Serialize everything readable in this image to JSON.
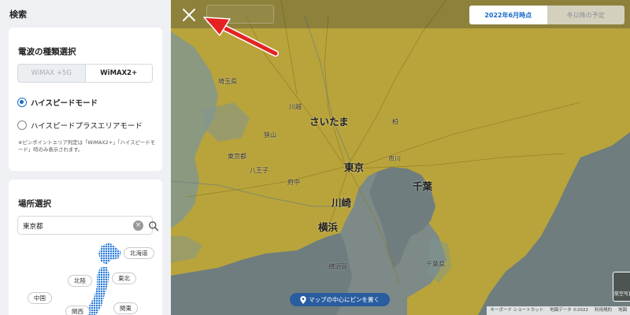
{
  "sidebar": {
    "title": "検索",
    "wave_section": {
      "heading": "電波の種類選択",
      "tabs": [
        "WiMAX +5G",
        "WiMAX2+"
      ],
      "modes": [
        "ハイスピードモード",
        "ハイスピードプラスエリアモード"
      ],
      "note": "※ピンポイントエリア判定は「WiMAX2+」「ハイスピードモード」時のみ表示されます。"
    },
    "place_section": {
      "heading": "場所選択",
      "search_value": "東京都",
      "regions": [
        "北海道",
        "北陸",
        "東北",
        "中国",
        "関西",
        "関東"
      ]
    }
  },
  "map": {
    "date_toggle": [
      "2022年6月時点",
      "冬以降の予定"
    ],
    "labels_major": [
      "さいたま",
      "東京",
      "千葉",
      "川崎",
      "横浜"
    ],
    "labels_minor": [
      "埼玉県",
      "川越",
      "柏",
      "東京都",
      "八王子",
      "府中",
      "狭山",
      "市川",
      "横須賀",
      "千葉県"
    ],
    "pin_button": "マップの中心にピンを置く",
    "attribution": [
      "キーボード ショートカット",
      "地図データ ©2022",
      "利用規約",
      "地図"
    ],
    "aerial_label": "航空写真"
  },
  "colors": {
    "accent": "#1769c9",
    "coverage": "#b9a43b",
    "sea": "#6f7d7e",
    "pin_button": "#2a5d9f",
    "arrow": "#e52222"
  }
}
